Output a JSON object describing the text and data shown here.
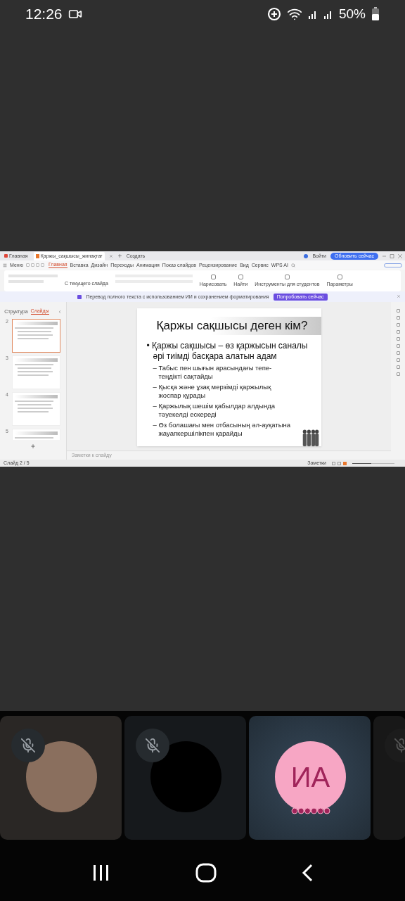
{
  "status_bar": {
    "time": "12:26",
    "battery": "50%"
  },
  "shared_screen": {
    "title_bar": {
      "home_tab": "Главная",
      "doc_tab": "Қаржы_сақшысы_жинақтағ",
      "new_tab": "Создать",
      "sign_in": "Войти",
      "update_button": "Обновить сейчас"
    },
    "menu": {
      "label": "Меню",
      "tabs": [
        {
          "label": "Главная",
          "selected": true
        },
        {
          "label": "Вставка",
          "selected": false
        },
        {
          "label": "Дизайн",
          "selected": false
        },
        {
          "label": "Переходы",
          "selected": false
        },
        {
          "label": "Анимация",
          "selected": false
        },
        {
          "label": "Показ слайдов",
          "selected": false
        },
        {
          "label": "Рецензирование",
          "selected": false
        },
        {
          "label": "Вид",
          "selected": false
        },
        {
          "label": "Сервис",
          "selected": false
        },
        {
          "label": "WPS AI",
          "selected": false
        }
      ]
    },
    "toolbar": {
      "from_slide": "С текущего слайда",
      "tools": [
        "Нарисовать",
        "Найти",
        "Инструменты для студентов",
        "Параметры"
      ]
    },
    "banner": {
      "text": "Перевод полного текста с использованием ИИ и сохранением форматирования",
      "button": "Попробовать сейчас"
    },
    "slide_panel": {
      "tabs": [
        {
          "label": "Структура",
          "selected": false
        },
        {
          "label": "Слайды",
          "selected": true
        }
      ],
      "thumbnails": [
        {
          "number": "2",
          "selected": true
        },
        {
          "number": "3",
          "selected": false
        },
        {
          "number": "4",
          "selected": false
        },
        {
          "number": "5",
          "selected": false
        }
      ]
    },
    "slide": {
      "title": "Қаржы сақшысы деген кім?",
      "bullets": [
        {
          "text": "• Қаржы сақшысы – өз қаржысын саналы әрі тиімді басқара алатын адам",
          "children": [
            {
              "text": "– Табыс пен шығын арасындағы тепе-теңдікті сақтайды"
            },
            {
              "text": "– Қысқа және ұзақ мерзімді қаржылық жоспар құрады"
            },
            {
              "text": "– Қаржылық шешім қабылдар алдында тәуекелді ескереді"
            },
            {
              "text": "– Өз болашағы мен отбасының әл-ауқатына жауапкершілікпен қарайды"
            }
          ]
        }
      ]
    },
    "notes_placeholder": "Заметки к слайду",
    "status": {
      "slide_count": "Слайд 2 / 5",
      "notes": "Заметки",
      "zoom_slider": {
        "level": 0.45
      }
    }
  },
  "participants": [
    {
      "kind": "photo",
      "muted": true
    },
    {
      "kind": "blank",
      "muted": true
    },
    {
      "kind": "initials",
      "initials": "ИА",
      "muted": false
    },
    {
      "kind": "partial",
      "muted": true
    }
  ]
}
